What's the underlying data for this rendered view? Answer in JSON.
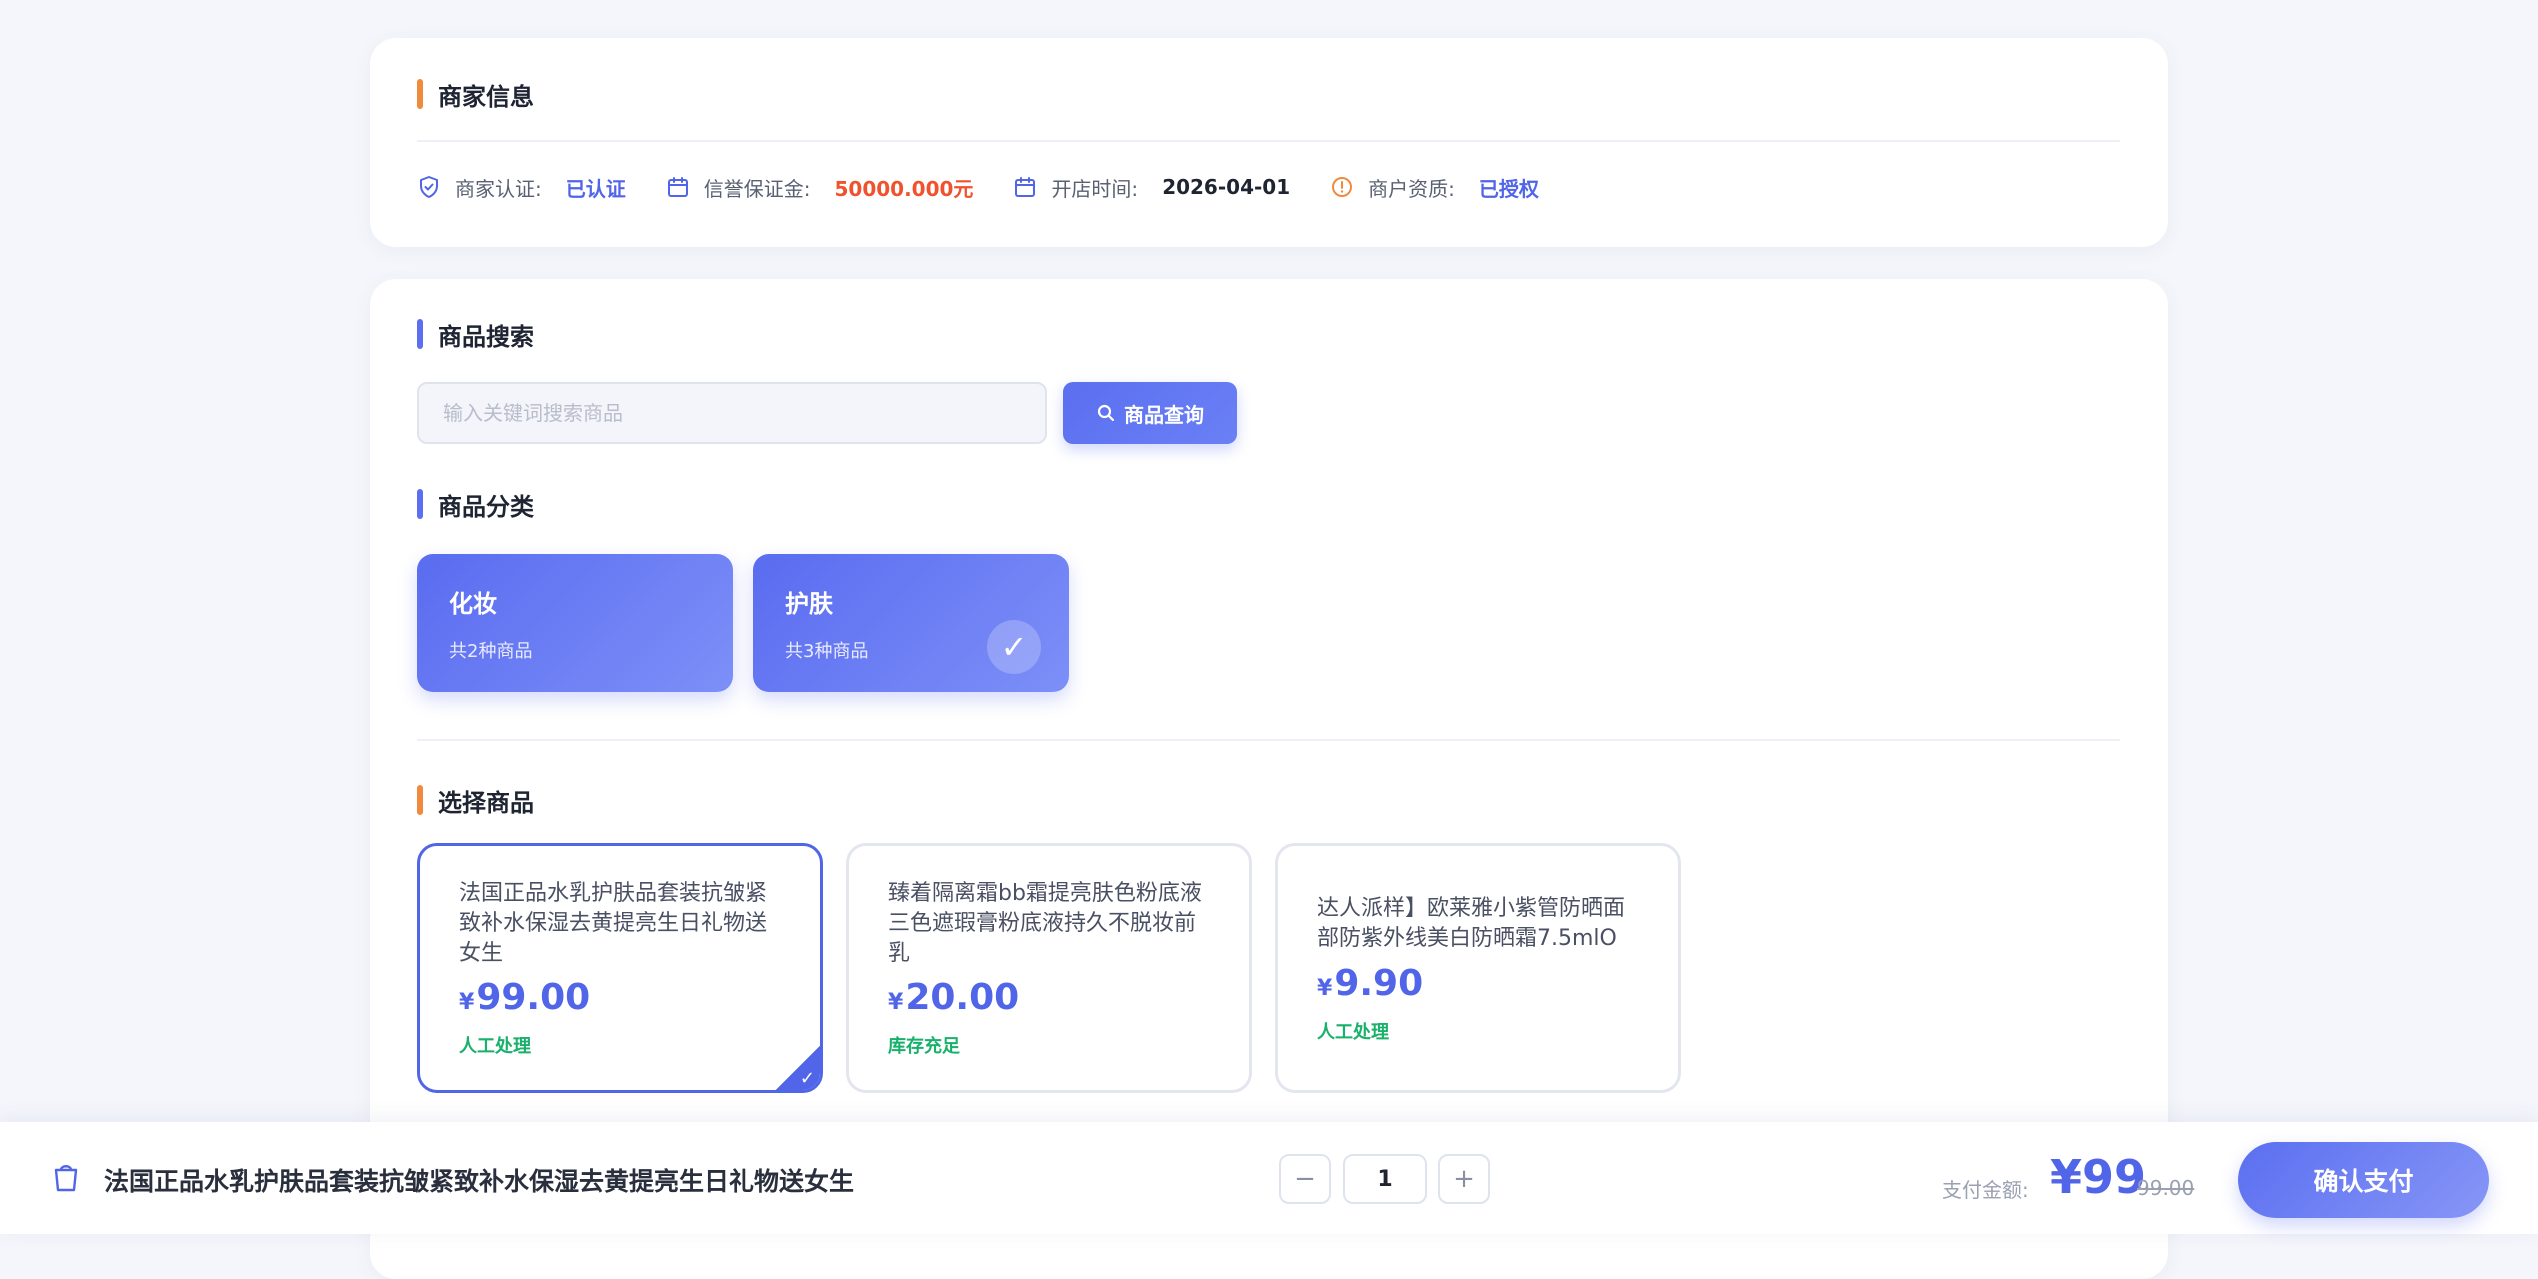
{
  "merchant": {
    "title": "商家信息",
    "items": [
      {
        "icon": "shield-check-icon",
        "label": "商家认证:",
        "value": "已认证"
      },
      {
        "icon": "calendar-icon",
        "label": "信誉保证金:",
        "value": "50000.000元"
      },
      {
        "icon": "calendar-icon",
        "label": "开店时间:",
        "value": "2026-04-01"
      },
      {
        "icon": "alert-circle-icon",
        "label": "商户资质:",
        "value": "已授权"
      }
    ]
  },
  "search": {
    "title": "商品搜索",
    "placeholder": "输入关键词搜索商品",
    "button_label": "商品查询"
  },
  "categories": {
    "title": "商品分类",
    "items": [
      {
        "name": "化妆",
        "count": "共2种商品",
        "selected": false
      },
      {
        "name": "护肤",
        "count": "共3种商品",
        "selected": true
      }
    ],
    "check_glyph": "✓"
  },
  "products": {
    "title": "选择商品",
    "items": [
      {
        "name": "法国正品水乳护肤品套装抗皱紧致补水保湿去黄提亮生日礼物送女生",
        "currency": "¥",
        "price": "99.00",
        "tag": "人工处理",
        "selected": true
      },
      {
        "name": "臻着隔离霜bb霜提亮肤色粉底液三色遮瑕膏粉底液持久不脱妆前乳",
        "currency": "¥",
        "price": "20.00",
        "tag": "库存充足",
        "selected": false
      },
      {
        "name": "达人派样】欧莱雅小紫管防晒面部防紫外线美白防晒霜7.5mlO",
        "currency": "¥",
        "price": "9.90",
        "tag": "人工处理",
        "selected": false
      }
    ],
    "check_glyph": "✓"
  },
  "bottom_bar": {
    "product_name": "法国正品水乳护肤品套装抗皱紧致补水保湿去黄提亮生日礼物送女生",
    "minus": "−",
    "quantity": "1",
    "plus": "+",
    "pay_label": "支付金额:",
    "pay_amount": "¥99",
    "original_price": "99.00",
    "confirm_label": "确认支付"
  },
  "colors": {
    "accent": "#5165e8",
    "orange_bar": "#f08a3c",
    "deposit_red": "#f0522e",
    "tag_green": "#19b06b"
  }
}
